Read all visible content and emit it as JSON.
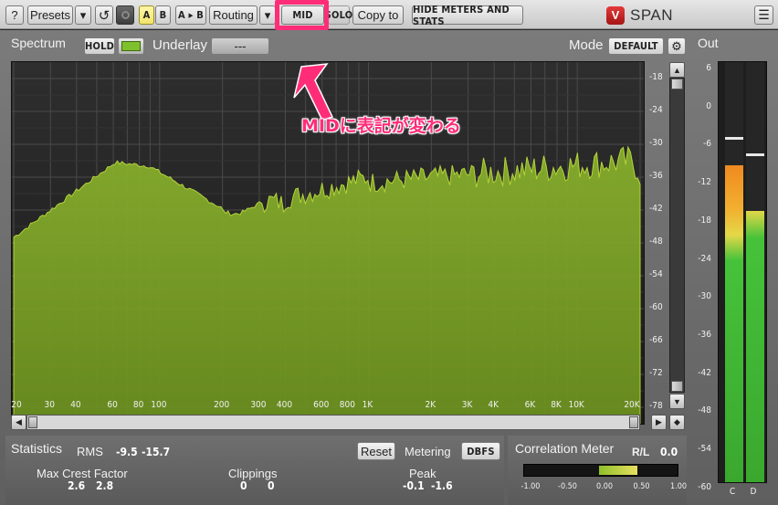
{
  "toolbar": {
    "help_label": "?",
    "presets_label": "Presets",
    "dropdown_arrow": "▾",
    "undo_label": "↺",
    "a_label": "A",
    "b_label": "B",
    "ab_copy_label": "A ▸ B",
    "routing_label": "Routing",
    "mid_label": "MID",
    "solo_label": "SOLO",
    "copy_to_label": "Copy to",
    "hide_meters_label": "HIDE METERS AND STATS",
    "menu_label": "☰"
  },
  "brand": {
    "name": "SPAN",
    "mark": "V"
  },
  "spectrum": {
    "title": "Spectrum",
    "hold_label": "HOLD",
    "underlay_label": "Underlay",
    "underlay_value": "---",
    "mode_label": "Mode",
    "mode_value": "DEFAULT",
    "y_ticks": [
      "-18",
      "-24",
      "-30",
      "-36",
      "-42",
      "-48",
      "-54",
      "-60",
      "-66",
      "-72",
      "-78"
    ],
    "x_ticks": [
      "20",
      "30",
      "40",
      "60",
      "80",
      "100",
      "200",
      "300",
      "400",
      "600",
      "800",
      "1K",
      "2K",
      "3K",
      "4K",
      "6K",
      "8K",
      "10K",
      "20K"
    ]
  },
  "annotation": {
    "text": "MIDに表記が変わる"
  },
  "statistics": {
    "title": "Statistics",
    "rms_label": "RMS",
    "rms_left": "-9.5",
    "rms_right": "-15.7",
    "reset_label": "Reset",
    "metering_label": "Metering",
    "metering_value": "DBFS",
    "crest_label": "Max Crest Factor",
    "crest_left": "2.6",
    "crest_right": "2.8",
    "clippings_label": "Clippings",
    "clip_left": "0",
    "clip_right": "0",
    "peak_label": "Peak",
    "peak_left": "-0.1",
    "peak_right": "-1.6"
  },
  "correlation": {
    "title": "Correlation Meter",
    "rl_label": "R/L",
    "rl_value": "0.0",
    "ticks": [
      "-1.00",
      "-0.50",
      "0.00",
      "0.50",
      "1.00"
    ]
  },
  "output": {
    "title": "Out",
    "ticks": [
      "6",
      "0",
      "-6",
      "-12",
      "-18",
      "-24",
      "-30",
      "-36",
      "-42",
      "-48",
      "-54",
      "-60"
    ],
    "left_channel": "C",
    "right_channel": "D"
  },
  "colors": {
    "accent": "#ff2d78",
    "spectrum_fill": "#7fa52a",
    "meter_green": "#3fbf3f",
    "meter_orange": "#f0a020"
  }
}
